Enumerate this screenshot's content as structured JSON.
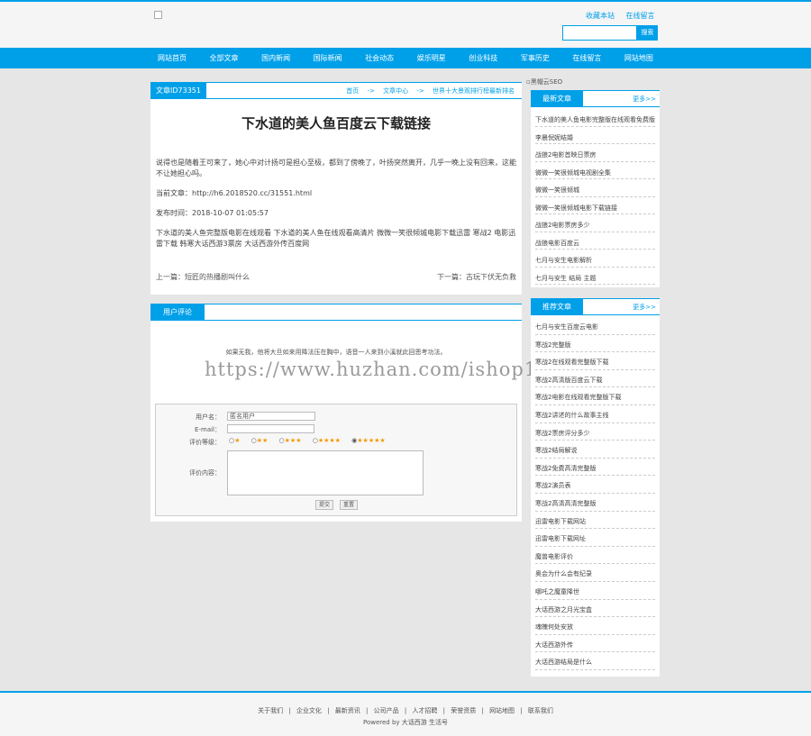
{
  "header": {
    "links": [
      "收藏本站",
      "在线留言"
    ],
    "search_button": "搜索"
  },
  "nav": [
    "网站首页",
    "全部文章",
    "国内新闻",
    "国际新闻",
    "社会动态",
    "娱乐明星",
    "创业科技",
    "军事历史",
    "在线留言",
    "网站地图"
  ],
  "article": {
    "tab": "文章ID73351",
    "breadcrumb": [
      "首页",
      "->",
      "文章中心",
      "->",
      "世界十大景观排行榜最新排名"
    ],
    "title": "下水道的美人鱼百度云下载链接",
    "intro": "说得也是随着王可来了，她心中对计扬可是担心至极，都到了傍晚了，叶扬突然离开，几乎一晚上没有回来，这能不让她担心吗。",
    "url_line": "当前文章：http://h6.2018520.cc/31551.html",
    "time_line": "发布时间：2018-10-07 01:05:57",
    "summary": "下水道的美人鱼完整版电影在线观看 下水道的美人鱼在线观看高清片 微微一笑很倾城电影下载迅雷 寒战2 电影迅雷下载 韩寒大话西游3票房 大话西游外传百度网",
    "prev": "上一篇：短匠的热播剧叫什么",
    "next": "下一篇：古玩下伏无负救"
  },
  "comments": {
    "tab": "用户评论",
    "notice": "如果无我，他将大旦如来用降法压在胸中，语音一人来到小溪就此回恩考功法。",
    "form": {
      "username_label": "用户名：",
      "username_value": "匿名用户",
      "email_label": "E-mail：",
      "rating_label": "评价等级：",
      "content_label": "评价内容：",
      "submit": "提交",
      "reset": "重置",
      "ratings": [
        "★",
        "★★",
        "★★★",
        "★★★★",
        "★★★★★"
      ]
    }
  },
  "watermark": "https://www.huzhan.com/ishop1012",
  "ad_image_alt": "黑帽云SEO",
  "sidebar": {
    "latest": {
      "title": "最新文章",
      "more": "更多>>",
      "items": [
        "下水道的美人鱼电影完整版在线观看免费版",
        "李晨倪妮结婚",
        "战狼2电影首映日票房",
        "微微一笑很倾城电视剧全集",
        "微微一笑很倾城",
        "微微一笑很倾城电影下载链接",
        "战狼2电影票房多少",
        "战狼电影百度云",
        "七月与安生电影解析",
        "七月与安生 结局 主题"
      ]
    },
    "recommend": {
      "title": "推荐文章",
      "more": "更多>>",
      "items": [
        "七月与安生百度云电影",
        "寒战2完整版",
        "寒战2在线观看完整版下载",
        "寒战2高清版百度云下载",
        "寒战2电影在线观看完整版下载",
        "寒战2讲述的什么故事主线",
        "寒战2票房评分多少",
        "寒战2结局解说",
        "寒战2免费高清完整版",
        "寒战2演员表",
        "寒战2高清高清完整版",
        "迅雷电影下载网站",
        "迅雷电影下载网址",
        "魔兽电影评价",
        "奥会为什么会有纪录",
        "哪吒之魔童降世",
        "大话西游之月光宝盒",
        "魂魄何处安放",
        "大话西游外传",
        "大话西游结局是什么"
      ]
    }
  },
  "footer": {
    "links": [
      "关于我们",
      "|",
      "企业文化",
      "|",
      "最新资讯",
      "|",
      "公司产品",
      "|",
      "人才招聘",
      "|",
      "荣誉资质",
      "|",
      "网站地图",
      "|",
      "联系我们"
    ],
    "powered": "Powered by 大话西游 生活号"
  },
  "colors": {
    "accent": "#00a0e9",
    "background": "#e6e6e6",
    "star": "#f39800"
  }
}
